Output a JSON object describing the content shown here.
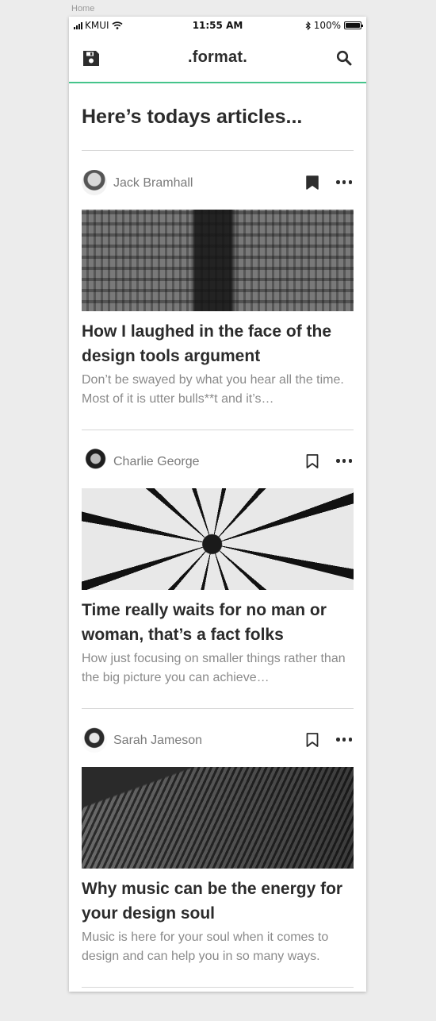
{
  "artboard": {
    "label": "Home"
  },
  "status_bar": {
    "carrier": "KMUI",
    "time": "11:55 AM",
    "battery_text": "100%",
    "icons": [
      "signal-icon",
      "wifi-icon",
      "bluetooth-icon",
      "battery-icon"
    ]
  },
  "nav": {
    "title": ".format.",
    "left_icon": "saved-icon",
    "right_icon": "search-icon",
    "accent_color": "#45c48b"
  },
  "page": {
    "heading": "Here’s todays articles..."
  },
  "articles": [
    {
      "author": "Jack Bramhall",
      "bookmarked": true,
      "title": "How I laughed in the face of the design tools argument",
      "excerpt": "Don’t be swayed by what you hear all the time. Most of it is utter bulls**t and it’s…"
    },
    {
      "author": "Charlie George",
      "bookmarked": false,
      "title": "Time really waits for no man or woman, that’s a fact folks",
      "excerpt": "How just focusing on smaller things rather than the big picture you can achieve…"
    },
    {
      "author": "Sarah Jameson",
      "bookmarked": false,
      "title": "Why music can be the energy for your design soul",
      "excerpt": "Music is here for your soul when it comes to design and can help you in so many ways."
    }
  ]
}
